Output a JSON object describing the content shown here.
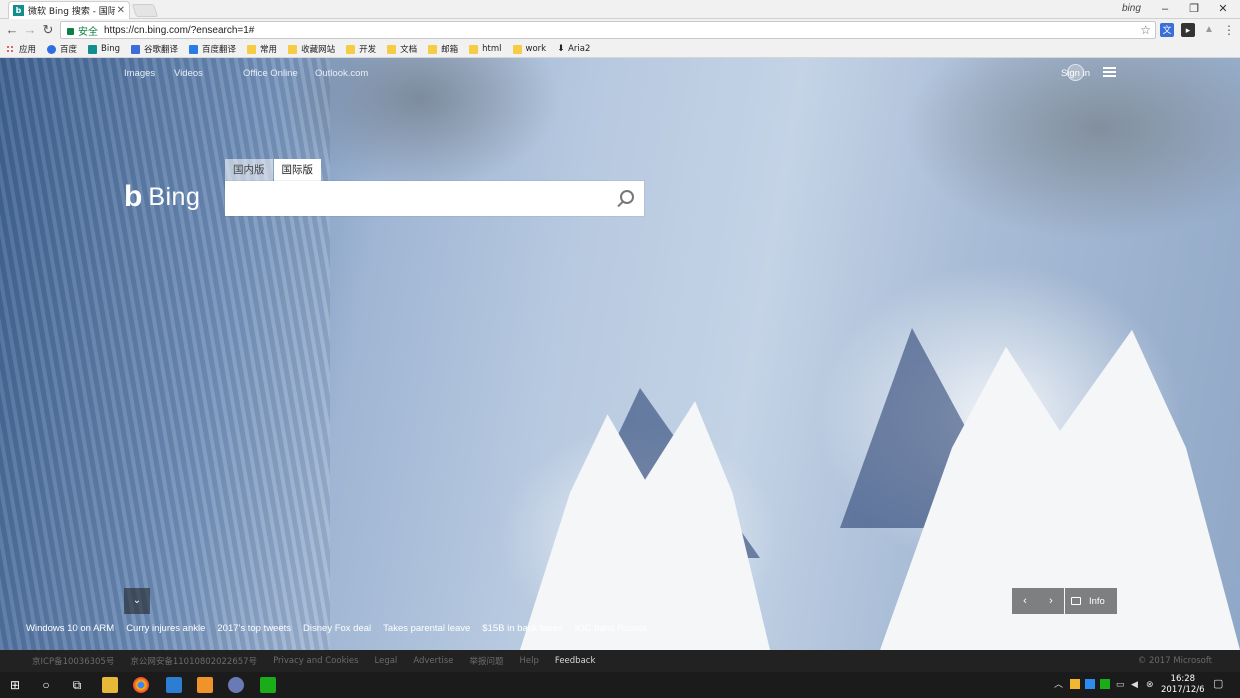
{
  "browser": {
    "tab_title": "微软 Bing 搜索 - 国际版",
    "window_label": "bing",
    "secure_label": "安全",
    "url": "https://cn.bing.com/?ensearch=1#",
    "bookmarks": [
      "应用",
      "百度",
      "Bing",
      "谷歌翻译",
      "百度翻译",
      "常用",
      "收藏网站",
      "开发",
      "文档",
      "邮箱",
      "html",
      "work",
      "Aria2"
    ]
  },
  "bing": {
    "nav": [
      "Images",
      "Videos",
      "Office Online",
      "Outlook.com"
    ],
    "signin": "Sign in",
    "logo_word": "Bing",
    "search_tabs": [
      "国内版",
      "国际版"
    ],
    "search_value": "",
    "info_label": "Info",
    "news": [
      "Windows 10 on ARM",
      "Curry injures ankle",
      "2017's top tweets",
      "Disney Fox deal",
      "Takes parental leave",
      "$15B in back taxes",
      "IOC bans Russia"
    ]
  },
  "footer": {
    "links": [
      "京ICP备10036305号",
      "京公网安备11010802022657号",
      "Privacy and Cookies",
      "Legal",
      "Advertise",
      "举报问题",
      "Help",
      "Feedback"
    ],
    "copyright": "© 2017 Microsoft"
  },
  "taskbar": {
    "time": "16:28",
    "date": "2017/12/6"
  }
}
